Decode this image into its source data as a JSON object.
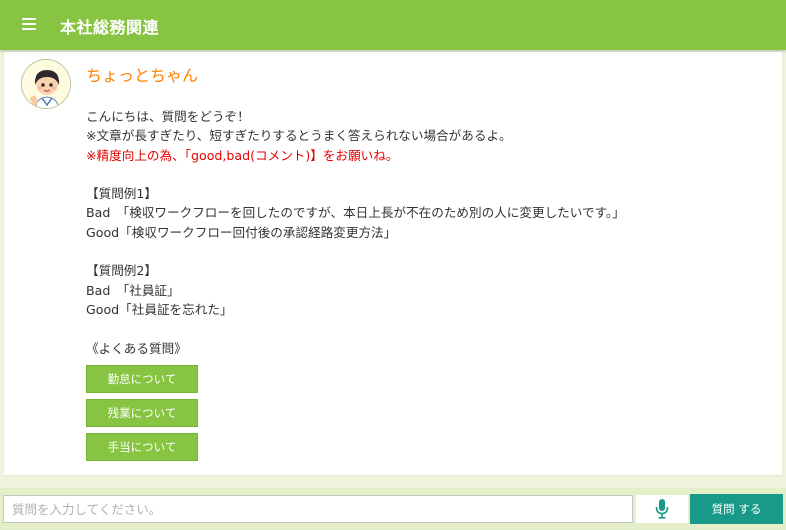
{
  "header": {
    "title": "本社総務関連",
    "menu_icon": "hamburger-menu-icon"
  },
  "colors": {
    "header_bg": "#86c442",
    "bot_name": "#ff7f00",
    "warning": "#e60000",
    "quick_button": "#86c442",
    "send_button": "#19998a",
    "page_bg": "#eef5dc"
  },
  "chat": {
    "bot_name": "ちょっとちゃん",
    "avatar_icon": "character-avatar-icon",
    "greeting": "こんにちは、質問をどうぞ！",
    "note": "※文章が長すぎたり、短すぎたりするとうまく答えられない場合があるよ。",
    "warning": "※精度向上の為、「good,bad(コメント)】をお願いね。",
    "example1_heading": "【質問例1】",
    "example1_bad": "Bad　「検収ワークフローを回したのですが、本日上長が不在のため別の人に変更したいです。」",
    "example1_good": "Good「検収ワークフロー回付後の承認経路変更方法」",
    "example2_heading": "【質問例2】",
    "example2_bad": "Bad　「社員証」",
    "example2_good": "Good「社員証を忘れた」",
    "faq_heading": "《よくある質問》",
    "faq_buttons": [
      "勤怠について",
      "残業について",
      "手当について"
    ]
  },
  "input": {
    "placeholder": "質問を入力してください。",
    "value": "",
    "mic_icon": "microphone-icon",
    "send_label": "質問 する"
  }
}
